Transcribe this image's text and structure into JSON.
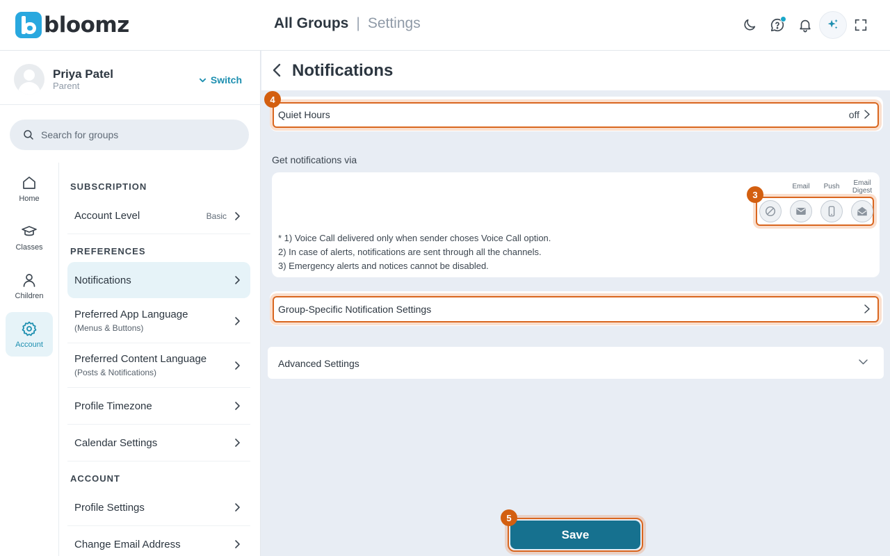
{
  "app": {
    "logo_text": "bloomz",
    "title_primary": "All Groups",
    "title_separator": "|",
    "title_secondary": "Settings"
  },
  "profile": {
    "name": "Priya Patel",
    "role": "Parent",
    "switch_label": "Switch"
  },
  "search": {
    "placeholder": "Search for groups"
  },
  "rail": [
    {
      "label": "Home",
      "icon": "home-icon"
    },
    {
      "label": "Classes",
      "icon": "graduation-cap-icon"
    },
    {
      "label": "Children",
      "icon": "person-icon"
    },
    {
      "label": "Account",
      "icon": "gear-icon",
      "active": true
    }
  ],
  "menu": {
    "subscription_title": "SUBSCRIPTION",
    "account_level_label": "Account Level",
    "account_level_value": "Basic",
    "preferences_title": "PREFERENCES",
    "notifications_label": "Notifications",
    "app_language_label": "Preferred App Language",
    "app_language_sub": "(Menus & Buttons)",
    "content_language_label": "Preferred Content Language",
    "content_language_sub": "(Posts & Notifications)",
    "timezone_label": "Profile Timezone",
    "calendar_label": "Calendar Settings",
    "account_title": "ACCOUNT",
    "profile_settings_label": "Profile Settings",
    "change_email_label": "Change Email Address"
  },
  "main": {
    "title": "Notifications",
    "quiet_hours_label": "Quiet Hours",
    "quiet_hours_value": "off",
    "via_label": "Get notifications via",
    "channels": {
      "email": "Email",
      "push": "Push",
      "digest_line1": "Email",
      "digest_line2": "Digest"
    },
    "notes": [
      "* 1) Voice Call delivered only when sender choses Voice Call option.",
      "2) In case of alerts, notifications are sent through all the channels.",
      "3) Emergency alerts and notices cannot be disabled."
    ],
    "group_specific_label": "Group-Specific Notification Settings",
    "advanced_label": "Advanced Settings",
    "save_label": "Save"
  },
  "badges": {
    "quiet_hours": "4",
    "channels": "3",
    "save": "5"
  },
  "colors": {
    "accent": "#1d8fb0",
    "highlight": "#d9661f",
    "save": "#16718f"
  }
}
